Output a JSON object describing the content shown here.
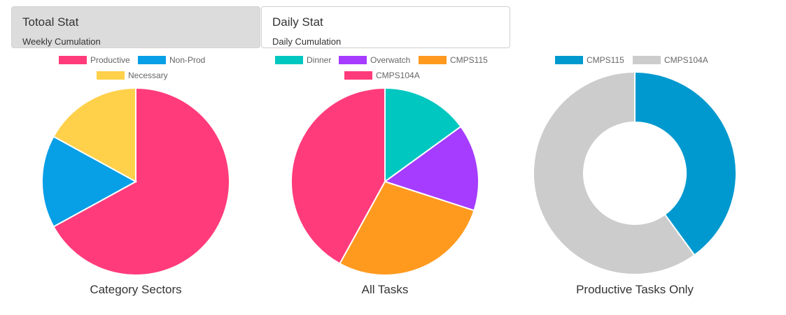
{
  "tabs": [
    {
      "title": "Totoal Stat",
      "subtitle": "Weekly Cumulation",
      "active": true
    },
    {
      "title": "Daily Stat",
      "subtitle": "Daily Cumulation",
      "active": false
    }
  ],
  "colors": {
    "Productive": "#ff3b7b",
    "Non-Prod": "#079fe6",
    "Necessary": "#ffd04a",
    "Dinner": "#00c7c0",
    "Overwatch": "#a53cff",
    "CMPS115": "#ff9a1f",
    "CMPS104A": "#ff3b7b",
    "CMPS115-donut": "#0099cf",
    "CMPS104A-donut": "#cccccc"
  },
  "chart_data": [
    {
      "type": "pie",
      "title": "Category Sectors",
      "categories": [
        "Productive",
        "Non-Prod",
        "Necessary"
      ],
      "values": [
        67,
        16,
        17
      ],
      "legend": "top",
      "colors": [
        "#ff3b7b",
        "#079fe6",
        "#ffd04a"
      ]
    },
    {
      "type": "pie",
      "title": "All Tasks",
      "categories": [
        "Dinner",
        "Overwatch",
        "CMPS115",
        "CMPS104A"
      ],
      "values": [
        15,
        15,
        28,
        42
      ],
      "legend": "top",
      "colors": [
        "#00c7c0",
        "#a53cff",
        "#ff9a1f",
        "#ff3b7b"
      ]
    },
    {
      "type": "pie",
      "subtype": "doughnut",
      "title": "Productive Tasks Only",
      "categories": [
        "CMPS115",
        "CMPS104A"
      ],
      "values": [
        40,
        60
      ],
      "legend": "top",
      "colors": [
        "#0099cf",
        "#cccccc"
      ]
    }
  ]
}
